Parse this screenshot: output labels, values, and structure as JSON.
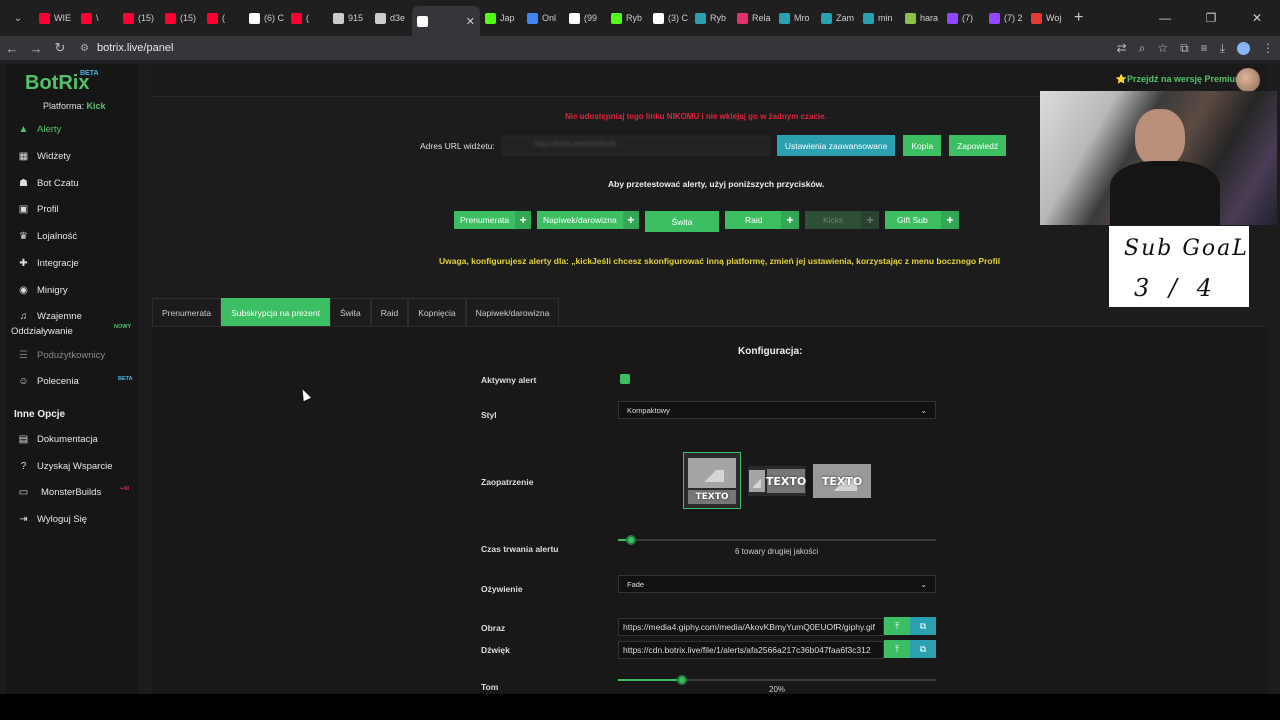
{
  "browser": {
    "tabs": [
      {
        "label": "WIE",
        "color": "#ff0033"
      },
      {
        "label": "\\",
        "color": "#ff0033"
      },
      {
        "label": "(15)",
        "color": "#ff0033"
      },
      {
        "label": "(15)",
        "color": "#ff0033"
      },
      {
        "label": "(",
        "color": "#ff0033"
      },
      {
        "label": "(6) C",
        "color": "#ffffff"
      },
      {
        "label": "(",
        "color": "#ff0033"
      },
      {
        "label": "915",
        "color": "#cccccc"
      },
      {
        "label": "d3e",
        "color": "#cccccc"
      },
      {
        "label": "",
        "color": "#ffffff",
        "active": true
      },
      {
        "label": "Jap",
        "color": "#53fc18"
      },
      {
        "label": "Onl",
        "color": "#4285f4"
      },
      {
        "label": "(99",
        "color": "#ffffff"
      },
      {
        "label": "Ryb",
        "color": "#53fc18"
      },
      {
        "label": "(3) C",
        "color": "#ffffff"
      },
      {
        "label": "Ryb",
        "color": "#2aa0b0"
      },
      {
        "label": "Rela",
        "color": "#e1306c"
      },
      {
        "label": "Mro",
        "color": "#2aa0b0"
      },
      {
        "label": "Zam",
        "color": "#2aa0b0"
      },
      {
        "label": "min",
        "color": "#2aa0b0"
      },
      {
        "label": "hara",
        "color": "#8bc34a"
      },
      {
        "label": "(7)",
        "color": "#9146ff"
      },
      {
        "label": "(7) 2",
        "color": "#9146ff"
      },
      {
        "label": "Woj",
        "color": "#e53935"
      }
    ],
    "url": "botrix.live/panel"
  },
  "sidebar": {
    "logo": "BotRix",
    "beta": "BETA",
    "platform_label": "Platforma:",
    "platform_value": "Kick",
    "items": [
      {
        "label": "Alerty",
        "icon": "warning-icon"
      },
      {
        "label": "Widżety",
        "icon": "grid-icon"
      },
      {
        "label": "Bot Czatu",
        "icon": "robot-icon"
      },
      {
        "label": "Profil",
        "icon": "id-card-icon"
      },
      {
        "label": "Lojalność",
        "icon": "trophy-icon"
      },
      {
        "label": "Integracje",
        "icon": "puzzle-icon"
      },
      {
        "label": "Minigry",
        "icon": "gamepad-icon"
      },
      {
        "label": "Wzajemne",
        "label2": "Oddziaływanie",
        "icon": "music-icon",
        "badge": "NOWY"
      },
      {
        "label": "Podużytkownicy",
        "icon": "users-icon"
      },
      {
        "label": "Polecenia",
        "icon": "user-group-icon",
        "badge": "BETA"
      }
    ],
    "other_title": "Inne Opcje",
    "other_items": [
      {
        "label": "Dokumentacja",
        "icon": "book-icon"
      },
      {
        "label": "Uzyskaj Wsparcie",
        "icon": "question-icon"
      },
      {
        "label": "MonsterBuilds",
        "icon": "monitor-icon",
        "badge": "+40"
      },
      {
        "label": "Wyloguj Się",
        "icon": "logout-icon"
      }
    ]
  },
  "header": {
    "premium": "⭐Przejdź na wersję Premium"
  },
  "widget": {
    "warning": "Nie udostępniaj tego linku NIKOMU i nie wklejaj go w żadnym czacie.",
    "url_label": "Adres URL widżetu:",
    "url_value": "https://botrix.live/alert/kick/...",
    "advanced_btn": "Ustawienia zaawansowane",
    "copy_btn": "Kopia",
    "preview_btn": "Zapowiedź",
    "test_hint": "Aby przetestować alerty, użyj poniższych przycisków.",
    "test_buttons": [
      "Prenumerata",
      "Napiwek/darowizna",
      "Świta",
      "Raid",
      "Kicks",
      "Gift Sub"
    ],
    "note": "Uwaga, konfigurujesz alerty dla: „kickJeśli chcesz skonfigurować inną platformę, zmień jej ustawienia, korzystając z menu bocznego Profil"
  },
  "alert_tabs": [
    "Prenumerata",
    "Subskrypcja na prezent",
    "Świta",
    "Raid",
    "Kopnięcia",
    "Napiwek/darowizna"
  ],
  "config": {
    "title": "Konfiguracja:",
    "active_label": "Aktywny alert",
    "style_label": "Styl",
    "style_value": "Kompaktowy",
    "layout_label": "Zaopatrzenie",
    "layout_text": "TEXTO",
    "duration_label": "Czas trwania alertu",
    "duration_value": "6 towary drugiej jakości",
    "duration_fraction": 0.04,
    "animation_label": "Ożywienie",
    "animation_value": "Fade",
    "image_label": "Obraz",
    "image_value": "https://media4.giphy.com/media/AkovKBmyYumQ0EUOfR/giphy.gif",
    "sound_label": "Dźwięk",
    "sound_value": "https://cdn.botrix.live/file/1/alerts/afa2566a217c36b047faa6f3c312",
    "volume_label": "Tom",
    "volume_value": "20%",
    "volume_fraction": 0.2
  },
  "overlay": {
    "goal_line1": "Sub GoaL",
    "goal_line2": "3 / 4"
  },
  "colors": {
    "accent": "#3cbf62",
    "teal": "#2aa0b0",
    "warning_red": "#e0233d",
    "note_yellow": "#e2d33a"
  }
}
